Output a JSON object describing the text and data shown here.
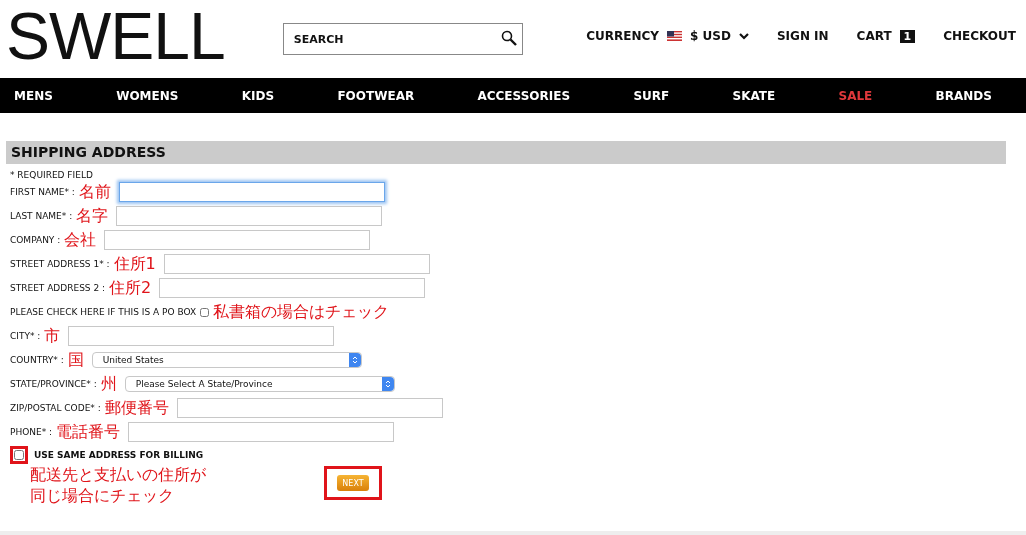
{
  "header": {
    "logo": "SWELL",
    "search": {
      "placeholder": "SEARCH"
    },
    "currency_label": "CURRENCY",
    "currency_value": "$ USD",
    "sign_in": "SIGN IN",
    "cart_label": "CART",
    "cart_count": "1",
    "checkout": "CHECKOUT"
  },
  "nav": [
    {
      "label": "MENS",
      "highlighted": false
    },
    {
      "label": "WOMENS",
      "highlighted": false
    },
    {
      "label": "KIDS",
      "highlighted": false
    },
    {
      "label": "FOOTWEAR",
      "highlighted": false
    },
    {
      "label": "ACCESSORIES",
      "highlighted": false
    },
    {
      "label": "SURF",
      "highlighted": false
    },
    {
      "label": "SKATE",
      "highlighted": false
    },
    {
      "label": "SALE",
      "highlighted": true
    },
    {
      "label": "BRANDS",
      "highlighted": false
    }
  ],
  "section_title": "SHIPPING ADDRESS",
  "required_note": "* REQUIRED FIELD",
  "fields": [
    {
      "kind": "text",
      "label": "FIRST NAME* :",
      "note": "名前",
      "focused": true
    },
    {
      "kind": "text",
      "label": "LAST NAME* :",
      "note": "名字",
      "focused": false
    },
    {
      "kind": "text",
      "label": "COMPANY :",
      "note": "会社",
      "focused": false
    },
    {
      "kind": "text",
      "label": "STREET ADDRESS 1* :",
      "note": "住所1",
      "focused": false
    },
    {
      "kind": "text",
      "label": "STREET ADDRESS 2 :",
      "note": "住所2",
      "focused": false
    },
    {
      "kind": "checkbox",
      "label": "PLEASE CHECK HERE IF THIS IS A PO BOX",
      "note": "私書箱の場合はチェック",
      "checked": false
    },
    {
      "kind": "text",
      "label": "CITY* :",
      "note": "市",
      "focused": false
    },
    {
      "kind": "select",
      "label": "COUNTRY* :",
      "note": "国",
      "value": "United States"
    },
    {
      "kind": "select",
      "label": "STATE/PROVINCE* :",
      "note": "州",
      "value": "Please Select A State/Province"
    },
    {
      "kind": "text",
      "label": "ZIP/POSTAL CODE* :",
      "note": "郵便番号",
      "focused": false
    },
    {
      "kind": "text",
      "label": "PHONE* :",
      "note": "電話番号",
      "focused": false
    }
  ],
  "billing": {
    "label": "USE SAME ADDRESS FOR BILLING",
    "checked": false,
    "marked": true,
    "note_lines": [
      "配送先と支払いの住所が",
      "同じ場合にチェック"
    ]
  },
  "next_button": {
    "label": "NEXT",
    "marked": true
  }
}
